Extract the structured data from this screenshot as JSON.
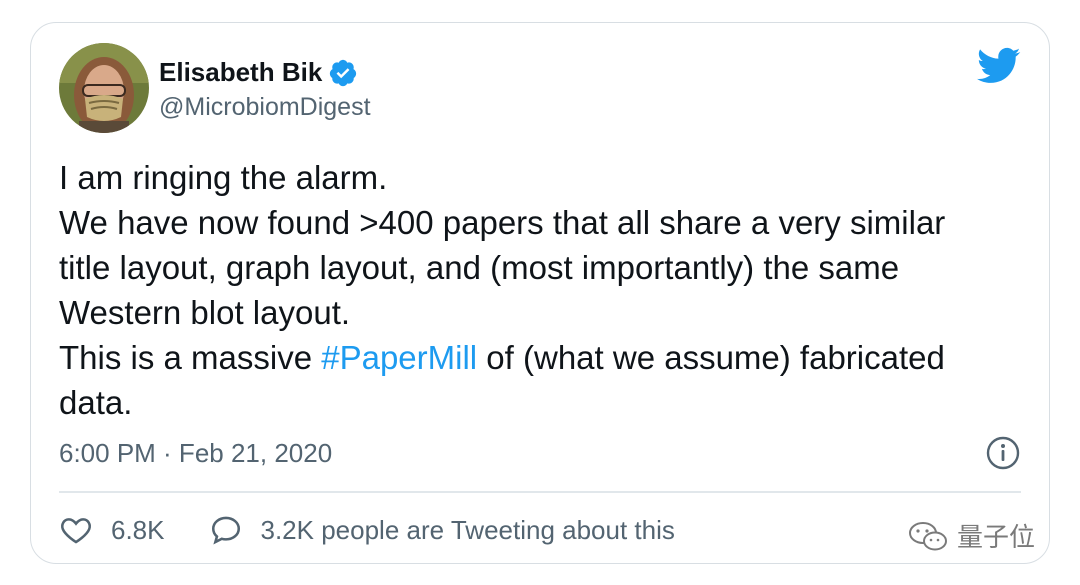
{
  "tweet": {
    "author_name": "Elisabeth Bik",
    "handle": "@MicrobiomDigest",
    "text_lines": [
      "I am ringing the alarm.",
      "We have now found >400 papers that all share a very similar",
      "title layout, graph layout, and (most importantly) the same",
      "Western blot layout."
    ],
    "line5_before": "This is a massive ",
    "hashtag": "#PaperMill",
    "line5_after": " of (what we assume) fabricated",
    "line6": "data.",
    "timestamp": "6:00 PM · Feb 21, 2020",
    "likes": "6.8K",
    "retweet_text": "3.2K people are Tweeting about this"
  },
  "watermark": {
    "text": "量子位"
  },
  "icons": {
    "verified": "verified-badge-icon",
    "brand": "twitter-bird-icon",
    "info": "info-icon",
    "like": "heart-icon",
    "reply": "speech-bubble-icon"
  },
  "colors": {
    "accent": "#1d9bf0",
    "text": "#0f1419",
    "muted": "#536471",
    "border": "#d8dee3"
  }
}
